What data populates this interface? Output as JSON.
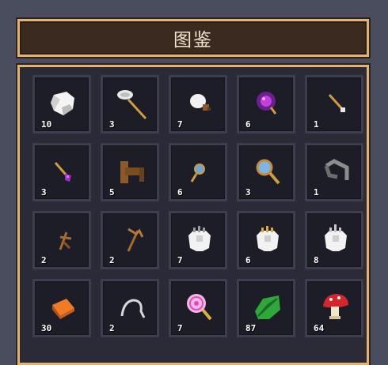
{
  "header": {
    "title": "图鉴"
  },
  "items": [
    {
      "icon": "cloth-icon",
      "count": "10"
    },
    {
      "icon": "net-icon",
      "count": "3"
    },
    {
      "icon": "meat-drumstick-icon",
      "count": "7"
    },
    {
      "icon": "purple-orb-icon",
      "count": "6"
    },
    {
      "icon": "needle-icon",
      "count": "1"
    },
    {
      "icon": "purple-wand-icon",
      "count": "3"
    },
    {
      "icon": "wooden-plank-icon",
      "count": "5"
    },
    {
      "icon": "small-magnifier-icon",
      "count": "6"
    },
    {
      "icon": "magnifier-icon",
      "count": "3"
    },
    {
      "icon": "grappling-hook-icon",
      "count": "1"
    },
    {
      "icon": "wooden-stick-icon",
      "count": "2"
    },
    {
      "icon": "wooden-rake-icon",
      "count": "2"
    },
    {
      "icon": "fur-pelt-gray-icon",
      "count": "7"
    },
    {
      "icon": "fur-pelt-gold-icon",
      "count": "6"
    },
    {
      "icon": "fur-pelt-silver-icon",
      "count": "8"
    },
    {
      "icon": "orange-brick-icon",
      "count": "30"
    },
    {
      "icon": "wire-icon",
      "count": "2"
    },
    {
      "icon": "lollipop-icon",
      "count": "7"
    },
    {
      "icon": "green-leaf-icon",
      "count": "87"
    },
    {
      "icon": "red-mushroom-icon",
      "count": "64"
    }
  ]
}
